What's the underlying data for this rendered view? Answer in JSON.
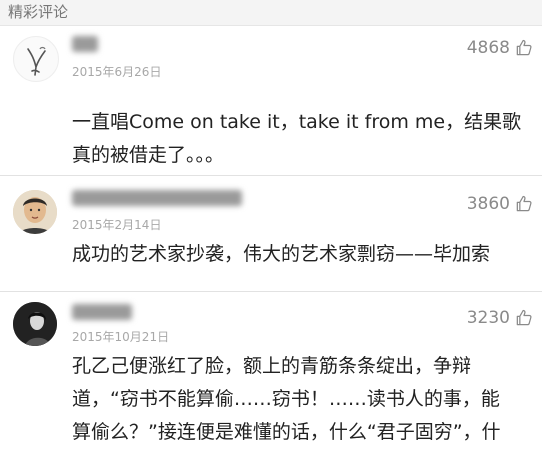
{
  "section": {
    "title": "精彩评论"
  },
  "comments": [
    {
      "date": "2015年6月26日",
      "likes": "4868",
      "text": "一直唱Come on take it，take it from me，结果歌\n真的被借走了。。。"
    },
    {
      "date": "2015年2月14日",
      "likes": "3860",
      "text": "成功的艺术家抄袭，伟大的艺术家剽窃——毕加索"
    },
    {
      "date": "2015年10月21日",
      "likes": "3230",
      "text": "孔乙己便涨红了脸，额上的青筋条条绽出，争辩\n道，“窃书不能算偷……窃书！……读书人的事，能\n算偷么？”接连便是难懂的话，什么“君子固穷”，什"
    }
  ],
  "icons": {
    "like": "thumbs-up-icon"
  },
  "colors": {
    "header_bg": "#f4f4f4",
    "meta_gray": "#a8a8a8",
    "like_gray": "#8a8a8a",
    "text": "#222222"
  }
}
